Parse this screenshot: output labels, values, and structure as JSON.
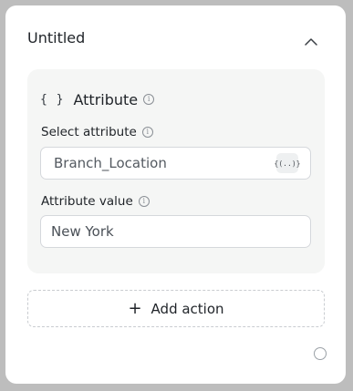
{
  "header": {
    "title": "Untitled",
    "collapse_icon": "chevron-up-icon"
  },
  "attribute_section": {
    "icon_text": "{ }",
    "title": "Attribute",
    "info_icon": "i",
    "select_attribute": {
      "label": "Select attribute",
      "value": "Branch_Location",
      "variable_button": "{(..)}"
    },
    "attribute_value": {
      "label": "Attribute value",
      "value": "New York"
    }
  },
  "actions": {
    "add_label": "Add action",
    "plus_icon": "+"
  },
  "colors": {
    "panel_bg": "#f5f6f5",
    "card_bg": "#ffffff",
    "outer_bg": "#bdbdbd",
    "border": "#d5d8dc"
  }
}
